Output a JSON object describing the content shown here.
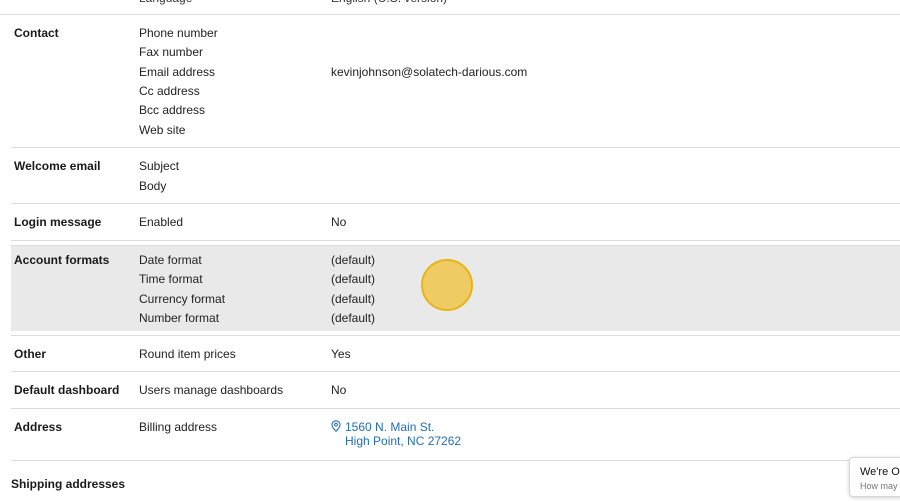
{
  "sections": {
    "contact": {
      "label": "Contact",
      "fields": [
        "Phone number",
        "Fax number",
        "Email address",
        "Cc address",
        "Bcc address",
        "Web site"
      ],
      "email_value": "kevinjohnson@solatech-darious.com"
    },
    "welcome_email": {
      "label": "Welcome email",
      "fields": [
        "Subject",
        "Body"
      ]
    },
    "login_message": {
      "label": "Login message",
      "field": "Enabled",
      "value": "No"
    },
    "account_formats": {
      "label": "Account formats",
      "fields": [
        "Date format",
        "Time format",
        "Currency format",
        "Number format"
      ],
      "values": [
        "(default)",
        "(default)",
        "(default)",
        "(default)"
      ]
    },
    "other": {
      "label": "Other",
      "field": "Round item prices",
      "value": "Yes"
    },
    "default_dashboard": {
      "label": "Default dashboard",
      "field": "Users manage dashboards",
      "value": "No"
    },
    "address": {
      "label": "Address",
      "field": "Billing address",
      "line1": "1560 N. Main St.",
      "line2": "High Point, NC 27262"
    },
    "shipping": {
      "label": "Shipping addresses"
    }
  },
  "chat_widget": {
    "title": "We're Or",
    "subtitle": "How may"
  },
  "colors": {
    "link": "#1f6fb5",
    "highlight_row": "#e9e9e9",
    "cursor_marker": "#f0c446"
  }
}
